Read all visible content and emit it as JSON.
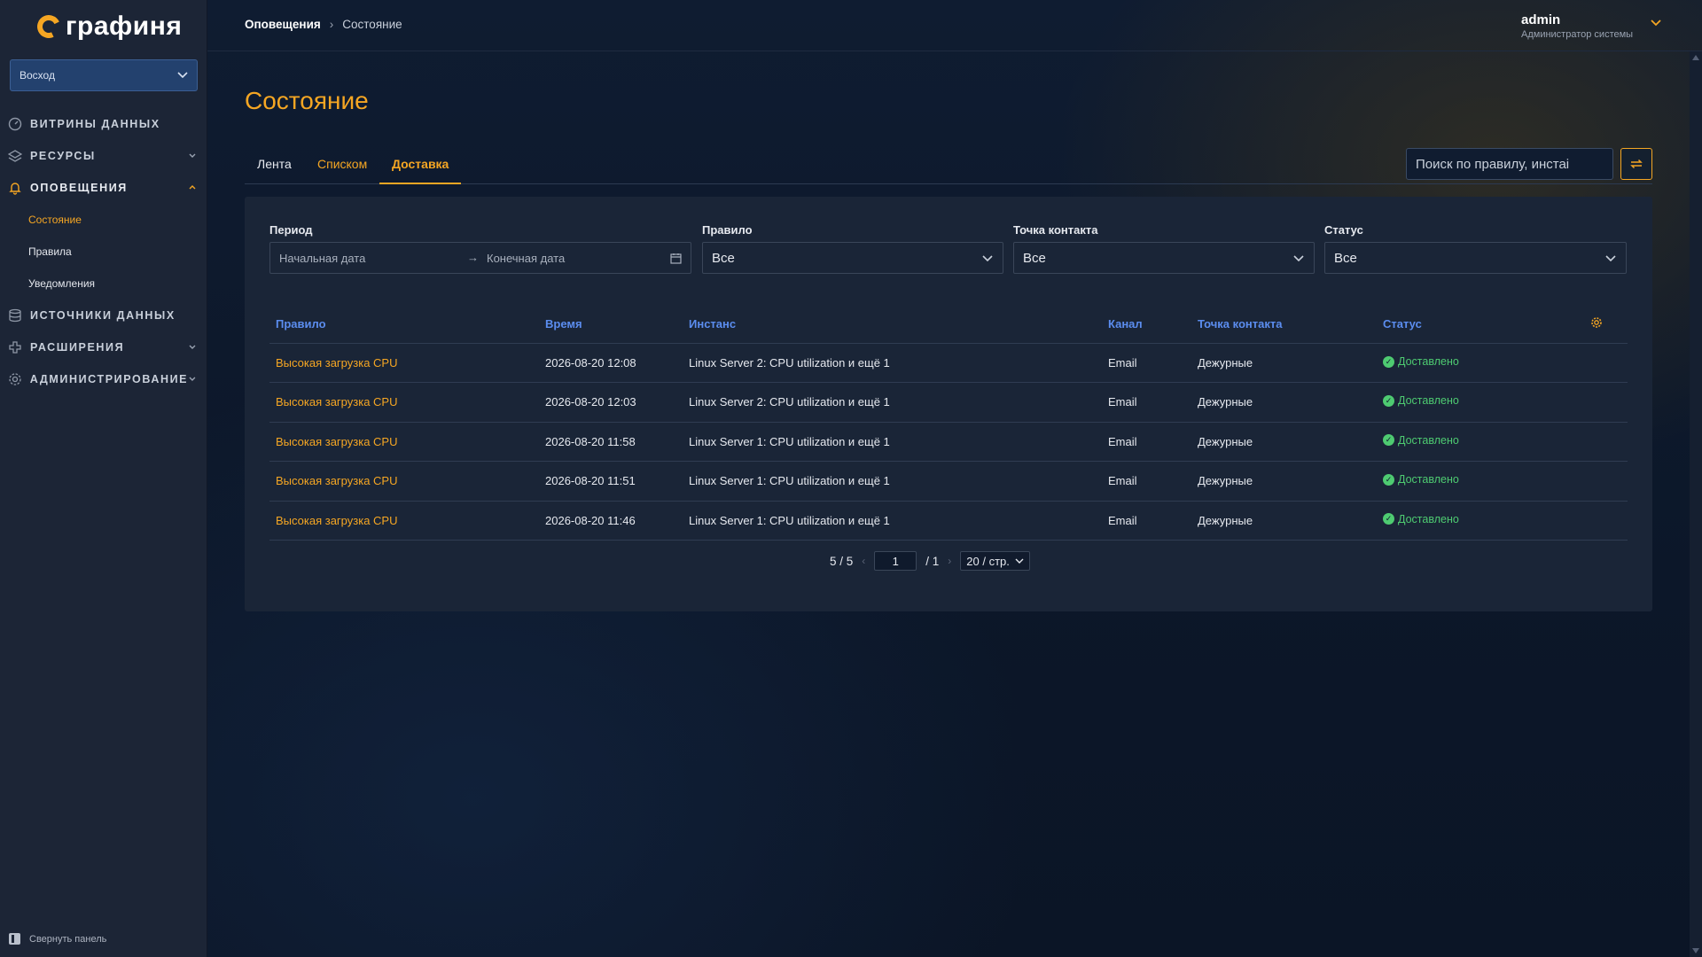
{
  "app": {
    "logo_text": "графиня"
  },
  "sidebar": {
    "org_select": "Восход",
    "items": [
      {
        "label": "ВИТРИНЫ ДАННЫХ"
      },
      {
        "label": "РЕСУРСЫ"
      },
      {
        "label": "ОПОВЕЩЕНИЯ"
      },
      {
        "label": "ИСТОЧНИКИ ДАННЫХ"
      },
      {
        "label": "РАСШИРЕНИЯ"
      },
      {
        "label": "АДМИНИСТРИРОВАНИЕ"
      }
    ],
    "sub_items": [
      {
        "label": "Состояние"
      },
      {
        "label": "Правила"
      },
      {
        "label": "Уведомления"
      }
    ],
    "collapse_label": "Свернуть панель"
  },
  "header": {
    "breadcrumb": [
      "Оповещения",
      "Состояние"
    ],
    "user_name": "admin",
    "user_role": "Администратор системы"
  },
  "page": {
    "title": "Состояние",
    "tabs": [
      {
        "label": "Лента"
      },
      {
        "label": "Списком"
      },
      {
        "label": "Доставка"
      }
    ],
    "search_placeholder": "Поиск по правилу, инстаі"
  },
  "filters": {
    "period_label": "Период",
    "start_placeholder": "Начальная дата",
    "end_placeholder": "Конечная дата",
    "rule_label": "Правило",
    "rule_value": "Все",
    "contact_label": "Точка контакта",
    "contact_value": "Все",
    "status_label": "Статус",
    "status_value": "Все"
  },
  "table": {
    "columns": [
      "Правило",
      "Время",
      "Инстанс",
      "Канал",
      "Точка контакта",
      "Статус"
    ],
    "rows": [
      {
        "rule": "Высокая загрузка CPU",
        "time": "2026-08-20 12:08",
        "instance": "Linux Server 2: CPU utilization и ещё 1",
        "channel": "Email",
        "contact": "Дежурные",
        "status": "Доставлено"
      },
      {
        "rule": "Высокая загрузка CPU",
        "time": "2026-08-20 12:03",
        "instance": "Linux Server 2: CPU utilization и ещё 1",
        "channel": "Email",
        "contact": "Дежурные",
        "status": "Доставлено"
      },
      {
        "rule": "Высокая загрузка CPU",
        "time": "2026-08-20 11:58",
        "instance": "Linux Server 1: CPU utilization и ещё 1",
        "channel": "Email",
        "contact": "Дежурные",
        "status": "Доставлено"
      },
      {
        "rule": "Высокая загрузка CPU",
        "time": "2026-08-20 11:51",
        "instance": "Linux Server 1: CPU utilization и ещё 1",
        "channel": "Email",
        "contact": "Дежурные",
        "status": "Доставлено"
      },
      {
        "rule": "Высокая загрузка CPU",
        "time": "2026-08-20 11:46",
        "instance": "Linux Server 1: CPU utilization и ещё 1",
        "channel": "Email",
        "contact": "Дежурные",
        "status": "Доставлено"
      }
    ]
  },
  "pagination": {
    "total": "5 / 5",
    "current_page": "1",
    "total_pages": "/ 1",
    "page_size": "20 / стр."
  },
  "colors": {
    "accent": "#f5a623",
    "link_header": "#5b8def",
    "success": "#4ecb71"
  }
}
